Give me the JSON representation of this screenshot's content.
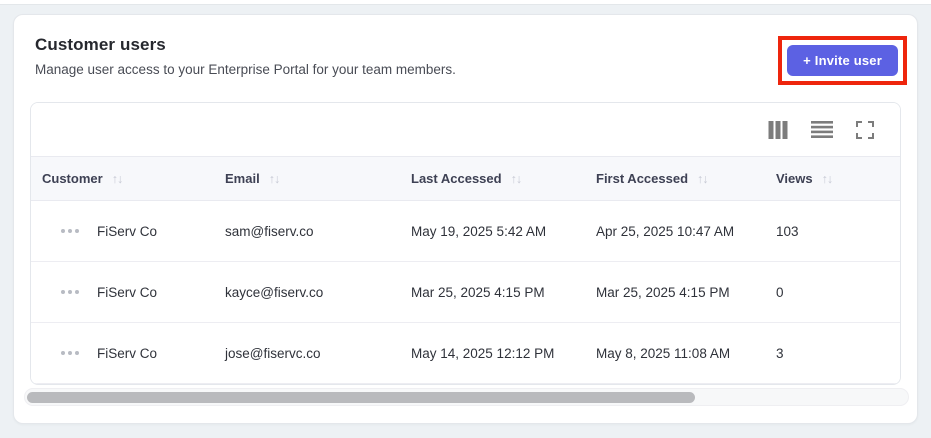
{
  "page": {
    "title": "Customer users",
    "subtitle": "Manage user access to your Enterprise Portal for your team members.",
    "invite_button_label": "+ Invite user"
  },
  "icons": {
    "sort": "↑↓",
    "toolbar": [
      "columns-icon",
      "density-icon",
      "fullscreen-icon"
    ]
  },
  "colors": {
    "accent_indigo": "#5c61e3",
    "highlight_red": "#ee250d",
    "page_background": "#edf1f4",
    "header_row_background": "#f7f8fb"
  },
  "table": {
    "columns": [
      {
        "label": "Customer",
        "sortable": true
      },
      {
        "label": "Email",
        "sortable": true
      },
      {
        "label": "Last Accessed",
        "sortable": true
      },
      {
        "label": "First Accessed",
        "sortable": true
      },
      {
        "label": "Views",
        "sortable": true
      }
    ],
    "rows": [
      {
        "customer": "FiServ Co",
        "email": "sam@fiserv.co",
        "last_accessed": "May 19, 2025 5:42 AM",
        "first_accessed": "Apr 25, 2025 10:47 AM",
        "views": "103"
      },
      {
        "customer": "FiServ Co",
        "email": "kayce@fiserv.co",
        "last_accessed": "Mar 25, 2025 4:15 PM",
        "first_accessed": "Mar 25, 2025 4:15 PM",
        "views": "0"
      },
      {
        "customer": "FiServ Co",
        "email": "jose@fiservc.co",
        "last_accessed": "May 14, 2025 12:12 PM",
        "first_accessed": "May 8, 2025 11:08 AM",
        "views": "3"
      }
    ]
  }
}
